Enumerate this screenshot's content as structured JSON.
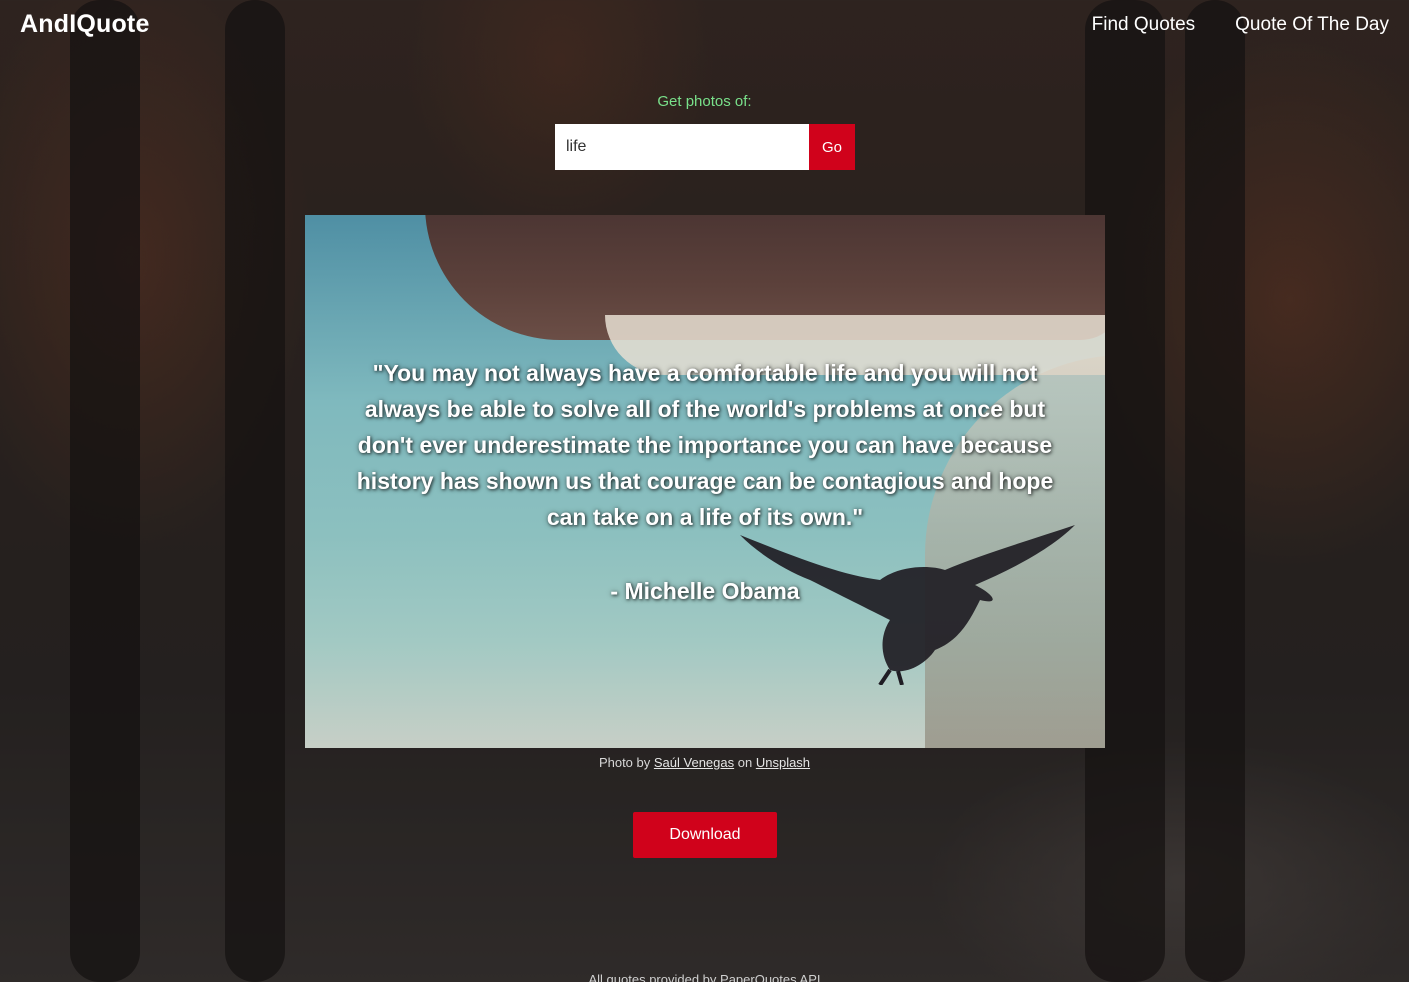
{
  "header": {
    "brand": "AndIQuote",
    "nav": [
      "Find Quotes",
      "Quote Of The Day"
    ]
  },
  "search": {
    "label": "Get photos of:",
    "value": "life",
    "go_label": "Go"
  },
  "quote": {
    "text": "\"You may not always have a comfortable life and you will not always be able to solve all of the world's problems at once but don't ever underestimate the importance you can have because history has shown us that courage can be contagious and hope can take on a life of its own.\"",
    "author": "- Michelle Obama"
  },
  "credit": {
    "prefix": "Photo by",
    "photographer": "Saúl Venegas",
    "middle": "on",
    "site": "Unsplash"
  },
  "download_label": "Download",
  "footer": {
    "text": "All quotes provided by PaperQuotes API"
  },
  "colors": {
    "accent": "#d0021b",
    "label_green": "#79e08a"
  }
}
